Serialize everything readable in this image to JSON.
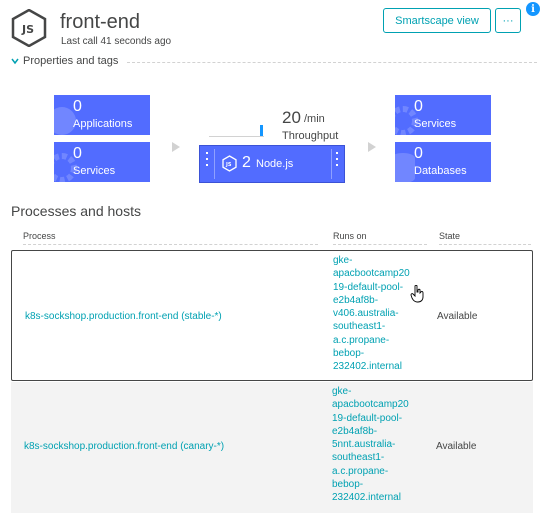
{
  "header": {
    "title": "front-end",
    "subtitle": "Last call 41 seconds ago",
    "smartscape_label": "Smartscape view",
    "more_label": "···",
    "info_label": "i"
  },
  "properties": {
    "label": "Properties and tags"
  },
  "flow": {
    "left_tiles": [
      {
        "count": "0",
        "label": "Applications"
      },
      {
        "count": "0",
        "label": "Services"
      }
    ],
    "right_tiles": [
      {
        "count": "0",
        "label": "Services"
      },
      {
        "count": "0",
        "label": "Databases"
      }
    ],
    "center": {
      "count": "2",
      "label": "Node.js"
    },
    "throughput": {
      "value": "20",
      "unit": "/min",
      "label": "Throughput"
    }
  },
  "processes": {
    "title": "Processes and hosts",
    "columns": [
      "Process",
      "Runs on",
      "State"
    ],
    "rows": [
      {
        "process": "k8s-sockshop.production.front-end (stable-*)",
        "runs_on": [
          "gke-",
          "apacbootcamp20",
          "19-default-pool-",
          "e2b4af8b-",
          "v406.australia-",
          "southeast1-",
          "a.c.propane-",
          "bebop-",
          "232402.internal"
        ],
        "state": "Available"
      },
      {
        "process": "k8s-sockshop.production.front-end (canary-*)",
        "runs_on": [
          "gke-",
          "apacbootcamp20",
          "19-default-pool-",
          "e2b4af8b-",
          "5nnt.australia-",
          "southeast1-",
          "a.c.propane-",
          "bebop-",
          "232402.internal"
        ],
        "state": "Available"
      }
    ]
  },
  "colors": {
    "tile": "#526cff",
    "accent": "#00a1b2",
    "info": "#1496ff"
  }
}
